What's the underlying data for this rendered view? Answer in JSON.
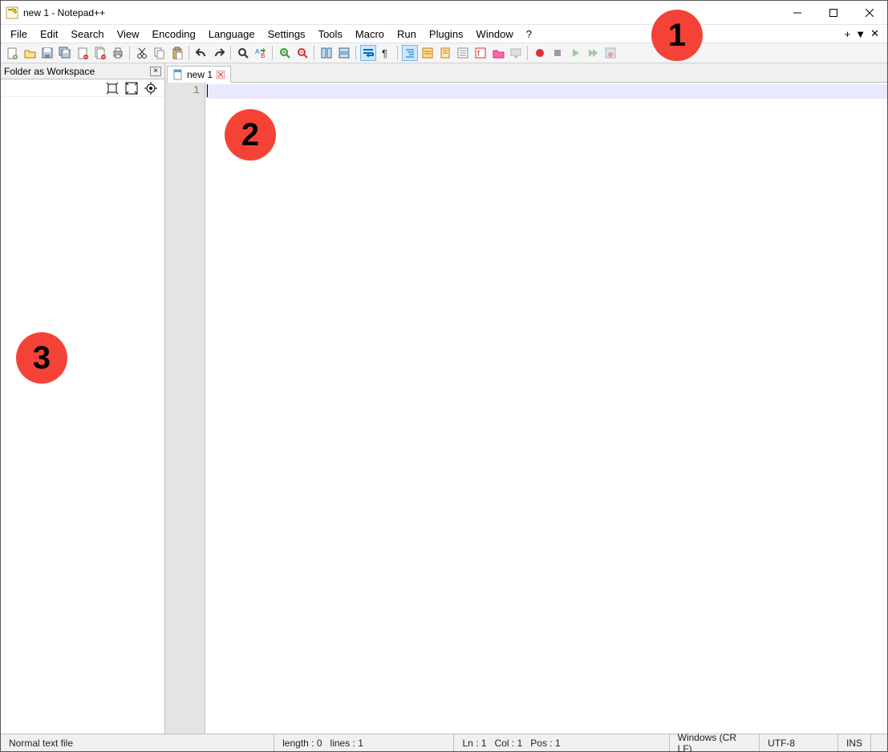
{
  "title": "new 1 - Notepad++",
  "menus": [
    "File",
    "Edit",
    "Search",
    "View",
    "Encoding",
    "Language",
    "Settings",
    "Tools",
    "Macro",
    "Run",
    "Plugins",
    "Window",
    "?"
  ],
  "extra_menu": {
    "plus": "+",
    "down": "▼",
    "x": "✕"
  },
  "toolbar": [
    {
      "name": "new-file-icon"
    },
    {
      "name": "open-file-icon"
    },
    {
      "name": "save-icon"
    },
    {
      "name": "save-all-icon"
    },
    {
      "name": "close-icon"
    },
    {
      "name": "close-all-icon"
    },
    {
      "name": "print-icon"
    },
    {
      "sep": true
    },
    {
      "name": "cut-icon"
    },
    {
      "name": "copy-icon"
    },
    {
      "name": "paste-icon"
    },
    {
      "sep": true
    },
    {
      "name": "undo-icon"
    },
    {
      "name": "redo-icon"
    },
    {
      "sep": true
    },
    {
      "name": "find-icon"
    },
    {
      "name": "replace-icon"
    },
    {
      "sep": true
    },
    {
      "name": "zoom-in-icon"
    },
    {
      "name": "zoom-out-icon"
    },
    {
      "sep": true
    },
    {
      "name": "sync-v-icon"
    },
    {
      "name": "sync-h-icon"
    },
    {
      "sep": true
    },
    {
      "name": "wordwrap-icon",
      "active": true
    },
    {
      "name": "show-all-chars-icon"
    },
    {
      "sep": true
    },
    {
      "name": "indent-guide-icon",
      "active": true
    },
    {
      "name": "lang-udl-icon"
    },
    {
      "name": "doc-map-icon"
    },
    {
      "name": "doc-list-icon"
    },
    {
      "name": "func-list-icon"
    },
    {
      "name": "folder-workspace-icon"
    },
    {
      "name": "monitor-icon",
      "disabled": true
    },
    {
      "sep": true
    },
    {
      "name": "record-macro-icon"
    },
    {
      "name": "stop-macro-icon",
      "disabled": true
    },
    {
      "name": "play-macro-icon",
      "disabled": true
    },
    {
      "name": "play-multi-icon",
      "disabled": true
    },
    {
      "name": "save-macro-icon",
      "disabled": true
    }
  ],
  "side": {
    "title": "Folder as Workspace",
    "tools": [
      "expand-icon",
      "collapse-icon",
      "locate-icon"
    ]
  },
  "tab": {
    "label": "new 1"
  },
  "gutter": {
    "line1": "1"
  },
  "status": {
    "filetype": "Normal text file",
    "length_label": "length :",
    "length_val": "0",
    "lines_label": "lines :",
    "lines_val": "1",
    "ln_label": "Ln :",
    "ln_val": "1",
    "col_label": "Col :",
    "col_val": "1",
    "pos_label": "Pos :",
    "pos_val": "1",
    "eol": "Windows (CR LF)",
    "encoding": "UTF-8",
    "ins": "INS"
  },
  "markers": {
    "m1": "1",
    "m2": "2",
    "m3": "3"
  }
}
